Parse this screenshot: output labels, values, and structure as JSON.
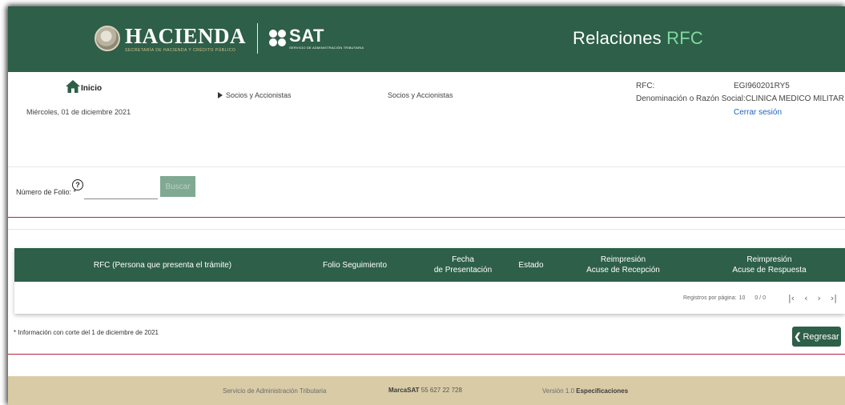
{
  "header": {
    "brand_hacienda": "HACIENDA",
    "brand_hacienda_sub": "SECRETARÍA DE HACIENDA Y CRÉDITO PÚBLICO",
    "brand_sat": "SAT",
    "brand_sat_sub": "SERVICIO DE ADMINISTRACIÓN TRIBUTARIA",
    "title_main": "Relaciones",
    "title_accent": "RFC",
    "header_color": "#2e5f48",
    "accent_color": "#7fd9a3"
  },
  "info": {
    "home_label": "Inicio",
    "date": "Miércoles, 01 de diciembre 2021",
    "breadcrumb_1": "Socios y Accionistas",
    "breadcrumb_2": "Socios y Accionistas",
    "rfc_label": "RFC:",
    "rfc_value": "EGI960201RY5",
    "razon_label": "Denominación o Razón Social:",
    "razon_value": "CLINICA MEDICO MILITAR SC",
    "logout": "Cerrar sesión"
  },
  "search": {
    "folio_label": "Número de Folio: *",
    "help_icon": "?",
    "folio_value": "",
    "button_label": "Buscar"
  },
  "table": {
    "columns": [
      [
        "RFC (Persona que presenta el trámite)"
      ],
      [
        "Folio Seguimiento"
      ],
      [
        "Fecha",
        "de Presentación"
      ],
      [
        "Estado"
      ],
      [
        "Reimpresión",
        "Acuse de Recepción"
      ],
      [
        "Reimpresión",
        "Acuse de Respuesta"
      ]
    ],
    "rows": [],
    "pager": {
      "rows_per_page_label": "Registros por página:",
      "rows_per_page": "10",
      "range": "0 / 0"
    }
  },
  "note": "* Información con corte del 1 de diciembre de 2021",
  "back_button": "Regresar",
  "footer": {
    "org": "Servicio de Administración Tributaria",
    "marca_label": "MarcaSAT",
    "marca_phone": "55 627 22 728",
    "version_label": "Versión 1.0",
    "specs": "Especificaciones"
  }
}
